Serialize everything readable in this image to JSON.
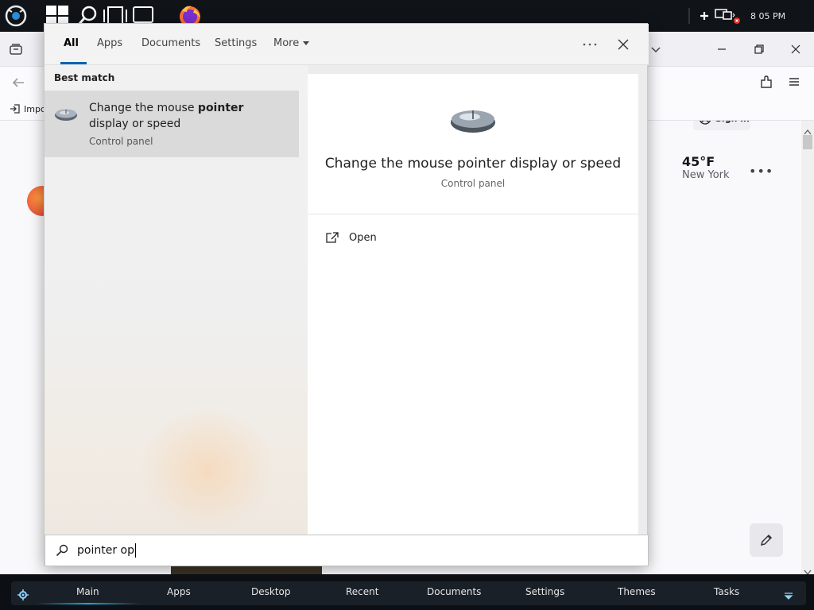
{
  "taskbar": {
    "icons": [
      "launcher-icon",
      "windows-start-icon",
      "search-icon",
      "task-view-icon",
      "notifications-icon",
      "firefox-icon"
    ],
    "tray": {
      "clock": "8 05 PM",
      "icons": [
        "plus-icon",
        "network-disconnected-icon"
      ]
    }
  },
  "browser": {
    "window_controls": [
      "minimize-icon",
      "restore-icon",
      "close-icon"
    ],
    "sign_in_label": "Sign in",
    "bookmark_label": "Impo",
    "weather": {
      "temperature": "45°F",
      "city": "New York"
    }
  },
  "search": {
    "tabs": [
      {
        "label": "All",
        "active": true
      },
      {
        "label": "Apps",
        "active": false
      },
      {
        "label": "Documents",
        "active": false
      },
      {
        "label": "Settings",
        "active": false
      },
      {
        "label": "More",
        "active": false
      }
    ],
    "best_match": {
      "heading": "Best match",
      "title_prefix": "Change the mouse ",
      "title_bold": "pointer",
      "title_suffix": "display or speed",
      "subtitle": "Control panel"
    },
    "detail": {
      "title": "Change the mouse pointer display or speed",
      "subtitle": "Control panel",
      "actions": [
        {
          "label": "Open",
          "icon": "open-external-icon"
        }
      ]
    },
    "query": "pointer op"
  },
  "dock": {
    "items": [
      "Main",
      "Apps",
      "Desktop",
      "Recent",
      "Documents",
      "Settings",
      "Themes",
      "Tasks"
    ],
    "active": "Main"
  }
}
